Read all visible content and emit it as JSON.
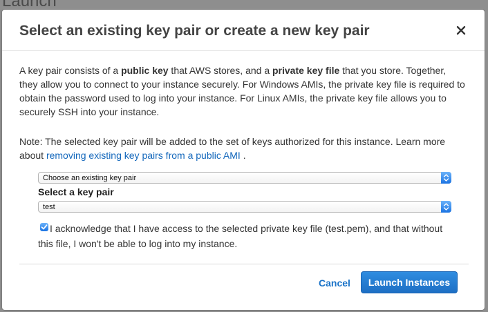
{
  "background": {
    "title": "Launch"
  },
  "modal": {
    "title": "Select an existing key pair or create a new key pair",
    "intro": {
      "t1": "A key pair consists of a ",
      "b1": "public key",
      "t2": " that AWS stores, and a ",
      "b2": "private key file",
      "t3": " that you store. Together, they allow you to connect to your instance securely. For Windows AMIs, the private key file is required to obtain the password used to log into your instance. For Linux AMIs, the private key file allows you to securely SSH into your instance."
    },
    "note": {
      "t1": "Note: The selected key pair will be added to the set of keys authorized for this instance. Learn more about ",
      "link": "removing existing key pairs from a public AMI",
      "t2": " ."
    },
    "key_pair_option": {
      "selected": "Choose an existing key pair"
    },
    "key_pair_select": {
      "label": "Select a key pair",
      "selected": "test"
    },
    "acknowledge": {
      "checked": true,
      "text": "I acknowledge that I have access to the selected private key file (test.pem), and that without this file, I won't be able to log into my instance."
    },
    "footer": {
      "cancel_label": "Cancel",
      "launch_label": "Launch Instances"
    }
  },
  "colors": {
    "accent": "#1a73e2",
    "link": "#1166bb",
    "title": "#444444",
    "primary_button": "#2f8de0"
  }
}
